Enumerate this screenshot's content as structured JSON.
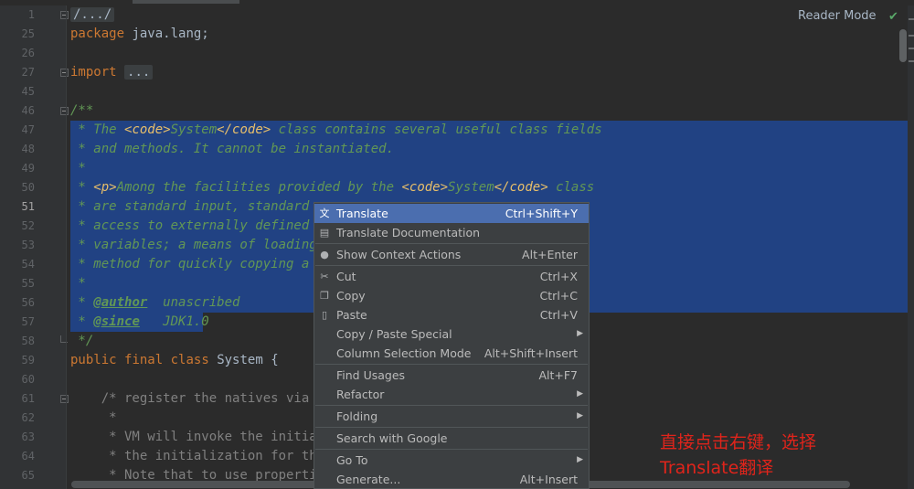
{
  "reader_mode": {
    "label": "Reader Mode"
  },
  "gutter": {
    "lines": [
      "1",
      "25",
      "26",
      "27",
      "45",
      "46",
      "47",
      "48",
      "49",
      "50",
      "51",
      "52",
      "53",
      "54",
      "55",
      "56",
      "57",
      "58",
      "59",
      "60",
      "61",
      "62",
      "63",
      "64",
      "65"
    ]
  },
  "code": {
    "folded_header": "/.../",
    "l25_kw": "package",
    "l25_rest": " java.lang;",
    "l27_kw": "import",
    "l27_fold": "...",
    "l46": "/**",
    "l47_a": " * The ",
    "l47_b": "<code>",
    "l47_c": "System",
    "l47_d": "</code>",
    "l47_e": " class contains several useful class fields",
    "l48": " * and methods. It cannot be instantiated.",
    "l49": " *",
    "l50_a": " * ",
    "l50_b": "<p>",
    "l50_c": "Among the facilities provided by the ",
    "l50_d": "<code>",
    "l50_e": "System",
    "l50_f": "</code>",
    "l50_g": " class",
    "l51": " * are standard input, standard o",
    "l52": " * access to externally defined p",
    "l53": " * variables; a means of loading f",
    "l54": " * method for quickly copying a po",
    "l55": " *",
    "l56_a": " * ",
    "l56_tag": "@author",
    "l56_b": "  unascribed",
    "l57_a": " * ",
    "l57_tag": "@since",
    "l57_b": "   JDK1.0",
    "l58": " */",
    "l59_kw1": "public",
    "l59_kw2": "final",
    "l59_kw3": "class",
    "l59_rest": " System {",
    "l60": "",
    "l61": "    /* register the natives via th",
    "l62": "     *",
    "l63": "     * VM will invoke the initiali",
    "l64": "     * the initialization for this",
    "l65": "     * Note that to use propertie"
  },
  "context_menu": {
    "translate": {
      "label": "Translate",
      "shortcut": "Ctrl+Shift+Y",
      "icon": "translate-icon"
    },
    "translate_doc": {
      "label": "Translate Documentation",
      "icon": "translate-doc-icon"
    },
    "show_context": {
      "label": "Show Context Actions",
      "shortcut": "Alt+Enter",
      "icon": "lightbulb-icon"
    },
    "cut": {
      "label": "Cut",
      "shortcut": "Ctrl+X",
      "icon": "scissors-icon"
    },
    "copy": {
      "label": "Copy",
      "shortcut": "Ctrl+C",
      "icon": "copy-icon"
    },
    "paste": {
      "label": "Paste",
      "shortcut": "Ctrl+V",
      "icon": "clipboard-icon"
    },
    "copy_paste_special": {
      "label": "Copy / Paste Special"
    },
    "column_selection": {
      "label": "Column Selection Mode",
      "shortcut": "Alt+Shift+Insert"
    },
    "find_usages": {
      "label": "Find Usages",
      "shortcut": "Alt+F7"
    },
    "refactor": {
      "label": "Refactor"
    },
    "folding": {
      "label": "Folding"
    },
    "search_google": {
      "label": "Search with Google"
    },
    "go_to": {
      "label": "Go To"
    },
    "generate": {
      "label": "Generate...",
      "shortcut": "Alt+Insert"
    }
  },
  "annotation": {
    "line1": "直接点击右键，选择",
    "line2": "Translate翻译"
  },
  "colors": {
    "background": "#2b2b2b",
    "selection": "#214283",
    "menu_highlight": "#4b6eaf",
    "annotation": "#e0241b"
  }
}
